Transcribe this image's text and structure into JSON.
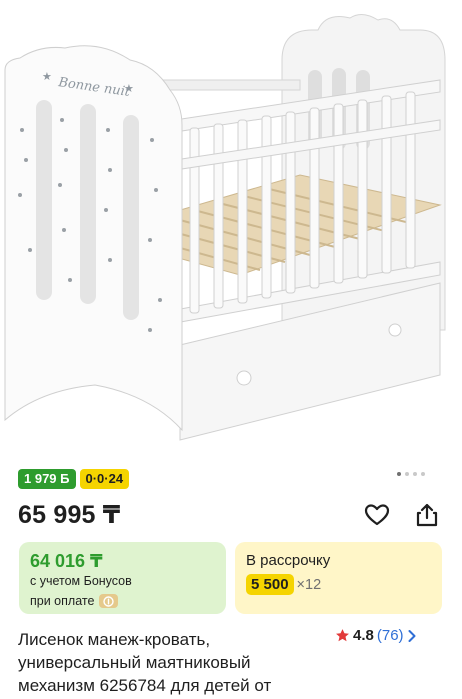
{
  "product": {
    "image_alt": "Лисенок манеж-кровать",
    "image_print": "Bonne nuit",
    "gallery": {
      "total": 4,
      "active": 1
    }
  },
  "badges": {
    "bonus": "1 979 Б",
    "installment": "0·0·24"
  },
  "price": {
    "main": "65 995 ₸"
  },
  "bonus_card": {
    "price": "64 016 ₸",
    "line1": "с учетом Бонусов",
    "line2": "при оплате"
  },
  "installment_card": {
    "title": "В рассрочку",
    "amount": "5 500",
    "months": "×12"
  },
  "title": "Лисенок манеж-кровать, универсальный маятниковый механизм 6256784 для детей от",
  "rating": {
    "value": "4.8",
    "count": "(76)"
  },
  "icons": {
    "favorite": "heart-icon",
    "share": "share-icon",
    "star": "star-icon",
    "chevron": "chevron-right-icon"
  },
  "colors": {
    "bonus_green": "#2e9c2e",
    "installment_yellow": "#f5d400",
    "bonus_card_bg": "#dff3cf",
    "installment_card_bg": "#fff6c8",
    "link_blue": "#2f6fd6",
    "star_red": "#e23a3a"
  }
}
